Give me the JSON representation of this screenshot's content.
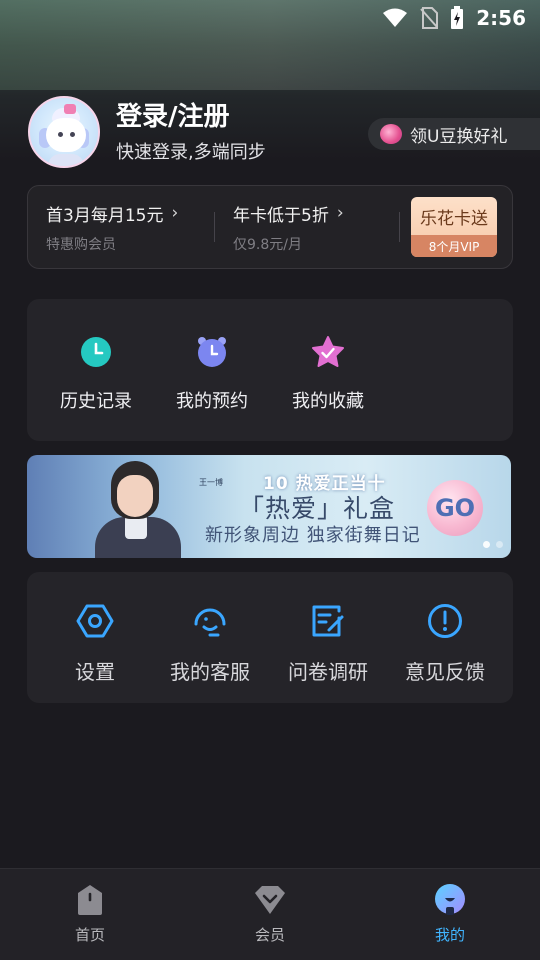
{
  "status_bar": {
    "time": "2:56"
  },
  "profile": {
    "title": "登录/注册",
    "subtitle": "快速登录,多端同步"
  },
  "promo_pill": {
    "label": "领U豆换好礼"
  },
  "vip_strip": {
    "offers": [
      {
        "title": "首3月每月15元",
        "subtitle": "特惠购会员"
      },
      {
        "title": "年卡低于5折",
        "subtitle": "仅9.8元/月"
      }
    ],
    "badge": {
      "title": "乐花卡送",
      "subtitle": "8个月VIP"
    }
  },
  "quick_actions": [
    {
      "label": "历史记录",
      "icon": "clock-icon",
      "color": "#25c9c1"
    },
    {
      "label": "我的预约",
      "icon": "alarm-clock-icon",
      "color": "#7c86f0"
    },
    {
      "label": "我的收藏",
      "icon": "star-icon",
      "color": "#e26fd1"
    }
  ],
  "banner": {
    "logo_text": "10 热爱正当十",
    "headline": "「热爱」礼盒",
    "subline": "新形象周边  独家街舞日记",
    "name_tag": "王一博",
    "cta": "GO",
    "page_count": 2,
    "active_page": 1
  },
  "tools": [
    {
      "label": "设置",
      "icon": "settings-hexagon-icon"
    },
    {
      "label": "我的客服",
      "icon": "customer-service-icon"
    },
    {
      "label": "问卷调研",
      "icon": "survey-edit-icon"
    },
    {
      "label": "意见反馈",
      "icon": "feedback-exclamation-icon"
    }
  ],
  "bottom_nav": [
    {
      "label": "首页",
      "icon": "home-icon",
      "active": false
    },
    {
      "label": "会员",
      "icon": "vip-diamond-icon",
      "active": false
    },
    {
      "label": "我的",
      "icon": "profile-icon",
      "active": true
    }
  ],
  "colors": {
    "accent": "#41b5ff",
    "tool_icon": "#3aa6ff",
    "background": "#1b1a1f"
  }
}
